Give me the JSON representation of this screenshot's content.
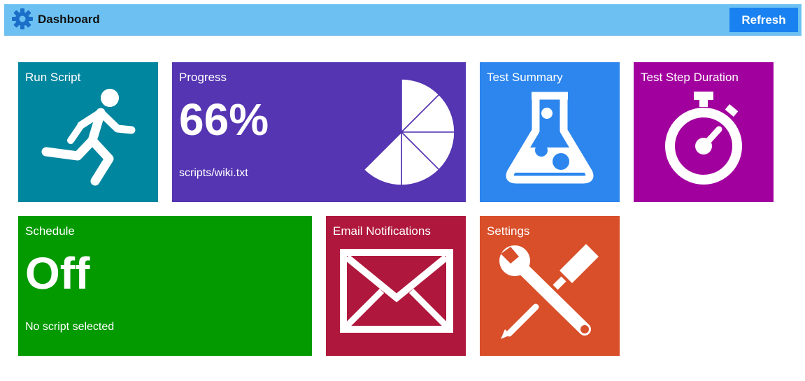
{
  "header": {
    "title": "Dashboard",
    "refresh_label": "Refresh",
    "icon": "gear-icon",
    "bar_color": "#6cc1f2",
    "button_color": "#1a82f0"
  },
  "tiles": {
    "run_script": {
      "label": "Run Script",
      "icon": "runner-icon",
      "color": "#00869e"
    },
    "progress": {
      "label": "Progress",
      "value": "66%",
      "file": "scripts/wiki.txt",
      "icon": "pie-progress-icon",
      "color": "#5535b2"
    },
    "test_summary": {
      "label": "Test Summary",
      "icon": "flask-icon",
      "color": "#2c86ee"
    },
    "test_step_duration": {
      "label": "Test Step Duration",
      "icon": "stopwatch-icon",
      "color": "#a2009e"
    },
    "schedule": {
      "label": "Schedule",
      "value": "Off",
      "status": "No script selected",
      "color": "#039a00"
    },
    "email_notifications": {
      "label": "Email Notifications",
      "icon": "envelope-icon",
      "color": "#b0173c"
    },
    "settings": {
      "label": "Settings",
      "icon": "tools-icon",
      "color": "#d84f2a"
    }
  }
}
